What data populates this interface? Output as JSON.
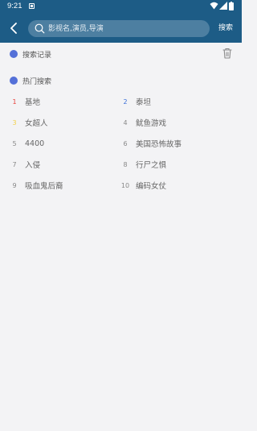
{
  "status": {
    "time": "9:21"
  },
  "header": {
    "search_placeholder": "影视名,演员,导演",
    "search_label": "搜索"
  },
  "history": {
    "title": "搜索记录"
  },
  "hot": {
    "title": "热门搜索",
    "items": [
      {
        "rank": "1",
        "name": "基地",
        "rank_color": "#e8413c"
      },
      {
        "rank": "2",
        "name": "泰坦",
        "rank_color": "#3b6fd8"
      },
      {
        "rank": "3",
        "name": "女超人",
        "rank_color": "#f2d14a"
      },
      {
        "rank": "4",
        "name": "鱿鱼游戏",
        "rank_color": "#888888"
      },
      {
        "rank": "5",
        "name": "4400",
        "rank_color": "#888888"
      },
      {
        "rank": "6",
        "name": "美国恐怖故事",
        "rank_color": "#888888"
      },
      {
        "rank": "7",
        "name": "入侵",
        "rank_color": "#888888"
      },
      {
        "rank": "8",
        "name": "行尸之惧",
        "rank_color": "#888888"
      },
      {
        "rank": "9",
        "name": "吸血鬼后裔",
        "rank_color": "#888888"
      },
      {
        "rank": "10",
        "name": "编码女仗",
        "rank_color": "#888888"
      }
    ]
  },
  "colors": {
    "appbar": "#1d5c86",
    "search_field": "#4d7fa1",
    "section_dot": "#5470d8",
    "background": "#f3f3f5"
  }
}
